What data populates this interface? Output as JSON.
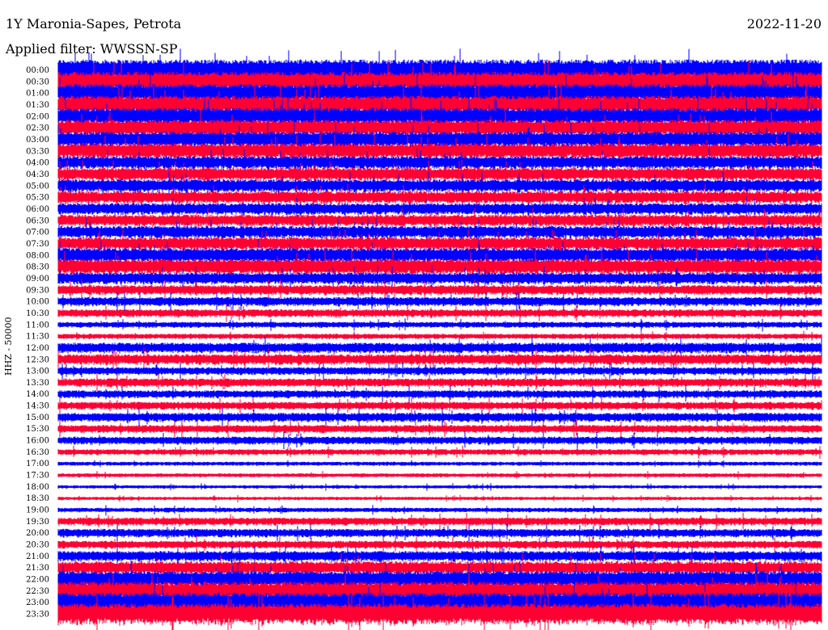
{
  "header": {
    "title": "1Y Maronia-Sapes, Petrota",
    "date": "2022-11-20",
    "filter": "Applied filter: WWSSN-SP"
  },
  "chart_data": {
    "type": "line",
    "title": "1Y Maronia-Sapes, Petrota",
    "ylabel": "HHZ - 50000",
    "row_labels": [
      "00:00",
      "00:30",
      "01:00",
      "01:30",
      "02:00",
      "02:30",
      "03:00",
      "03:30",
      "04:00",
      "04:30",
      "05:00",
      "05:30",
      "06:00",
      "06:30",
      "07:00",
      "07:30",
      "08:00",
      "08:30",
      "09:00",
      "09:30",
      "10:00",
      "10:30",
      "11:00",
      "11:30",
      "12:00",
      "12:30",
      "13:00",
      "13:30",
      "14:00",
      "14:30",
      "15:00",
      "15:30",
      "16:00",
      "16:30",
      "17:00",
      "17:30",
      "18:00",
      "18:30",
      "19:00",
      "19:30",
      "20:00",
      "20:30",
      "21:00",
      "21:30",
      "22:00",
      "22:30",
      "23:00",
      "23:30"
    ],
    "series_colors": [
      "#0000ff",
      "#ff0033"
    ],
    "relative_amplitude": [
      3.2,
      3.0,
      2.8,
      2.8,
      2.6,
      2.5,
      2.4,
      2.4,
      2.0,
      2.0,
      2.0,
      1.9,
      1.8,
      1.8,
      1.9,
      2.0,
      2.2,
      2.4,
      1.8,
      1.5,
      1.4,
      1.2,
      0.9,
      0.8,
      1.6,
      1.6,
      1.2,
      1.3,
      1.2,
      1.2,
      1.4,
      1.2,
      1.2,
      0.9,
      0.6,
      0.6,
      0.5,
      0.5,
      0.7,
      1.2,
      1.3,
      1.2,
      1.6,
      2.0,
      2.6,
      2.8,
      3.0,
      3.2
    ]
  }
}
